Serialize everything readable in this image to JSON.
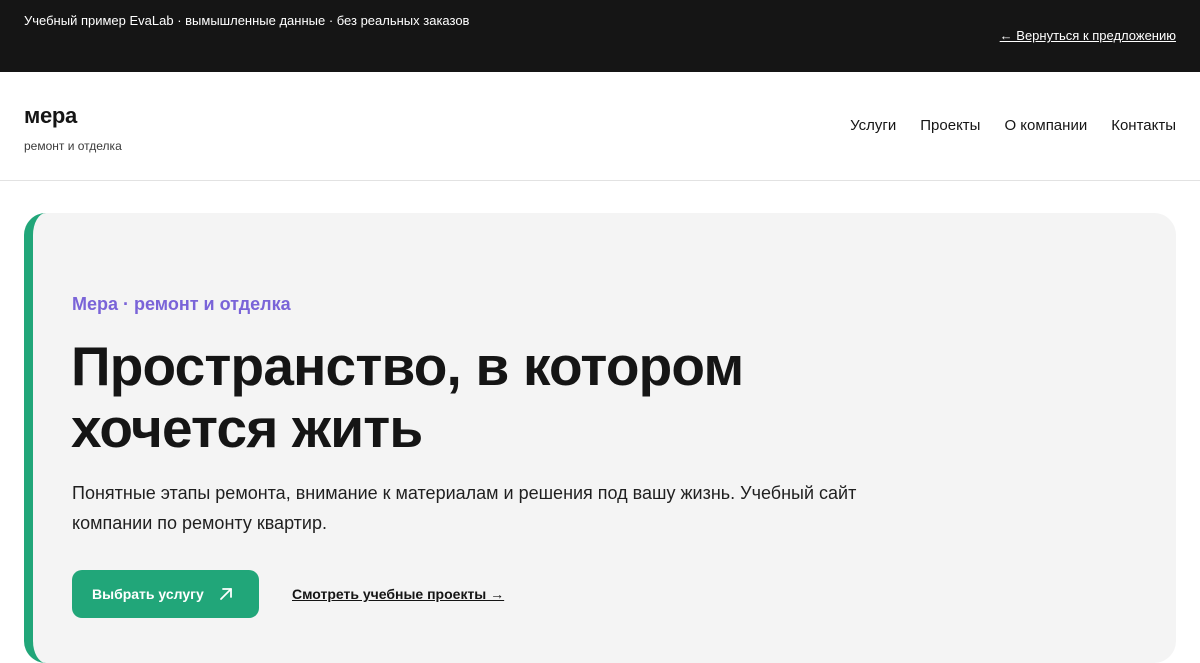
{
  "topbar": {
    "note": "Учебный пример EvaLab · вымышленные данные · без реальных заказов",
    "back_link": "← Вернуться к предложению"
  },
  "header": {
    "brand_name": "мера",
    "brand_tagline": "ремонт и отделка",
    "nav": [
      {
        "label": "Услуги"
      },
      {
        "label": "Проекты"
      },
      {
        "label": "О компании"
      },
      {
        "label": "Контакты"
      }
    ]
  },
  "hero": {
    "eyebrow": "Мера · ремонт и отделка",
    "title": "Пространство, в котором хочется жить",
    "description": "Понятные этапы ремонта, внимание к материалам и решения под вашу жизнь. Учебный сайт компании по ремонту квартир.",
    "cta_label": "Выбрать услугу",
    "cta_icon": "arrow-up-right-icon",
    "secondary_link": "Смотреть учебные проекты →"
  },
  "colors": {
    "topbar_bg": "#151515",
    "accent_green": "#21a679",
    "accent_purple": "#7a64d8",
    "hero_bg": "#f4f4f4"
  }
}
